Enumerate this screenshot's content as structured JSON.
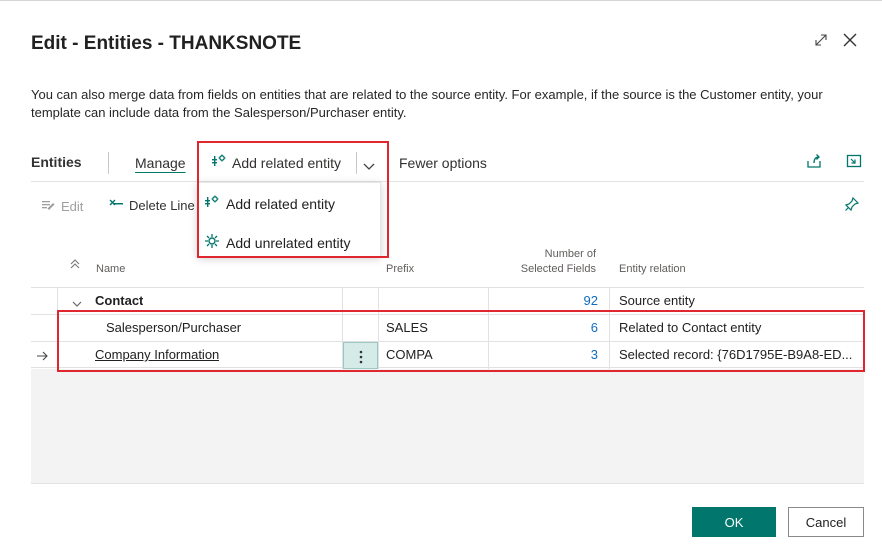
{
  "dialog": {
    "title": "Edit - Entities - THANKSNOTE",
    "description": "You can also merge data from fields on entities that are related to the source entity. For example, if the source is the Customer entity, your template can include data from the Salesperson/Purchaser entity."
  },
  "actionbar": {
    "section_label": "Entities",
    "manage_label": "Manage",
    "add_related_label": "Add related entity",
    "fewer_options_label": "Fewer options"
  },
  "subbar": {
    "edit_label": "Edit",
    "delete_label": "Delete Line"
  },
  "dropdown": {
    "items": [
      {
        "label": "Add related entity",
        "icon": "related-entity-icon"
      },
      {
        "label": "Add unrelated entity",
        "icon": "unrelated-entity-icon"
      }
    ]
  },
  "table": {
    "columns": {
      "name": "Name",
      "prefix": "Prefix",
      "number": "Number of Selected Fields",
      "relation": "Entity relation"
    },
    "rows": [
      {
        "name": "Contact",
        "prefix": "",
        "number": "92",
        "relation": "Source entity"
      },
      {
        "name": "Salesperson/Purchaser",
        "prefix": "SALES",
        "number": "6",
        "relation": "Related to Contact entity"
      },
      {
        "name": "Company Information",
        "prefix": "COMPA",
        "number": "3",
        "relation": "Selected record: {76D1795E-B9A8-ED..."
      }
    ]
  },
  "footer": {
    "ok_label": "OK",
    "cancel_label": "Cancel"
  },
  "colors": {
    "accent": "#00766c",
    "link": "#0f6cbd",
    "highlight": "#e0262f"
  }
}
